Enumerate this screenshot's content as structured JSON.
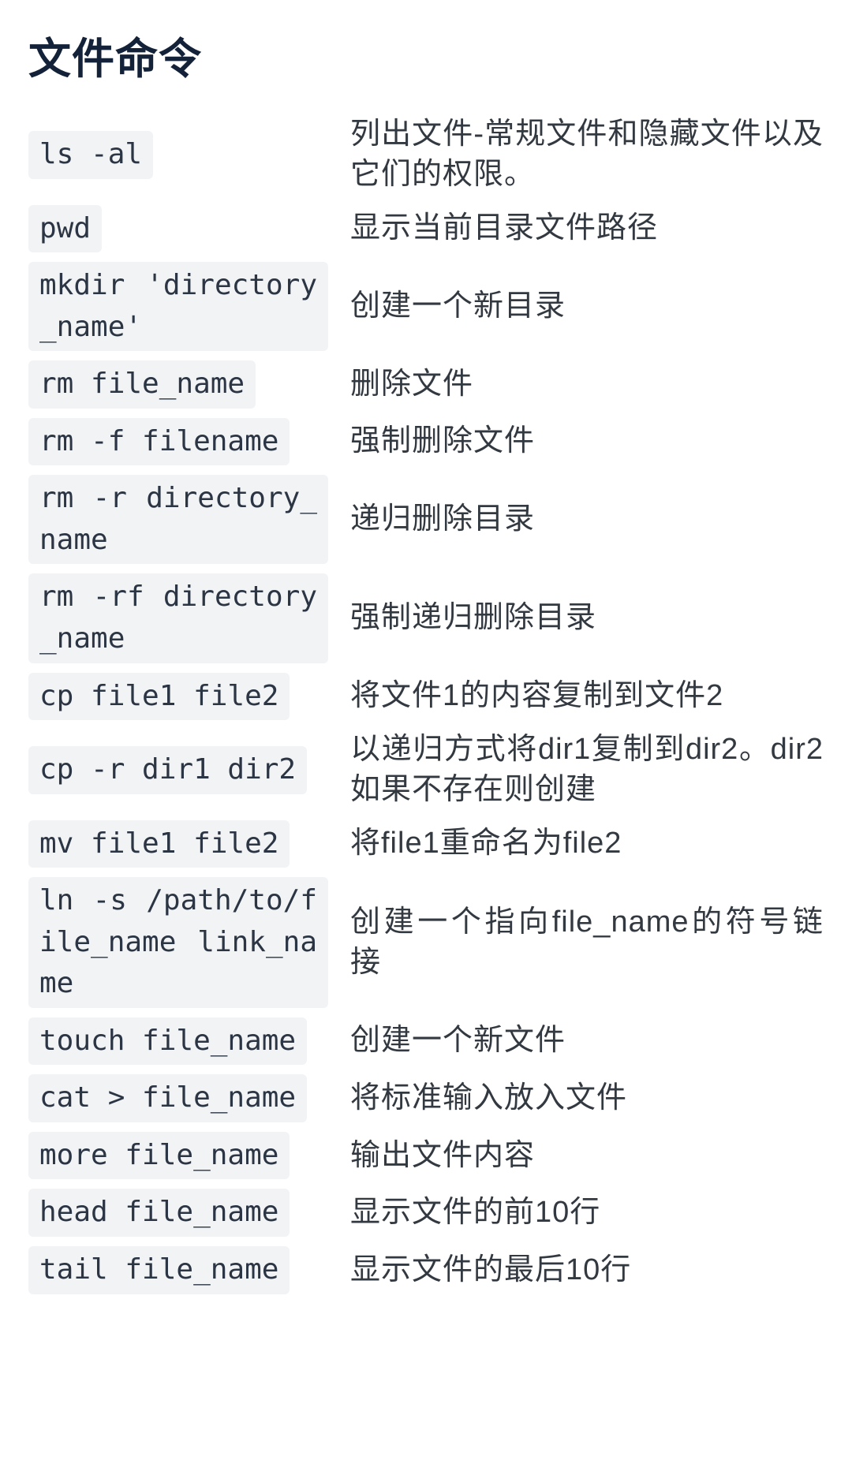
{
  "title": "文件命令",
  "rows": [
    {
      "cmd": "ls -al",
      "desc": "列出文件-常规文件和隐藏文件以及它们的权限。",
      "single": true
    },
    {
      "cmd": "pwd",
      "desc": "显示当前目录文件路径",
      "single": true
    },
    {
      "cmd": "mkdir 'directory_name'",
      "desc": "创建一个新目录",
      "single": false
    },
    {
      "cmd": "rm file_name",
      "desc": "删除文件",
      "single": true
    },
    {
      "cmd": "rm -f filename",
      "desc": "强制删除文件",
      "single": true
    },
    {
      "cmd": "rm -r directory_name",
      "desc": "递归删除目录",
      "single": false
    },
    {
      "cmd": "rm -rf directory_name",
      "desc": "强制递归删除目录",
      "single": false
    },
    {
      "cmd": "cp file1 file2",
      "desc": "将文件1的内容复制到文件2",
      "single": true
    },
    {
      "cmd": "cp -r dir1 dir2",
      "desc": "以递归方式将dir1复制到dir2。dir2如果不存在则创建",
      "single": true
    },
    {
      "cmd": "mv file1 file2",
      "desc": "将file1重命名为file2",
      "single": true
    },
    {
      "cmd": "ln -s /path/to/file_name link_name",
      "desc": "创建一个指向file_name的符号链接",
      "single": false
    },
    {
      "cmd": "touch file_name",
      "desc": "创建一个新文件",
      "single": true
    },
    {
      "cmd": "cat > file_name",
      "desc": "将标准输入放入文件",
      "single": true
    },
    {
      "cmd": "more file_name",
      "desc": "输出文件内容",
      "single": true
    },
    {
      "cmd": "head file_name",
      "desc": "显示文件的前10行",
      "single": true
    },
    {
      "cmd": "tail file_name",
      "desc": "显示文件的最后10行",
      "single": true
    }
  ]
}
